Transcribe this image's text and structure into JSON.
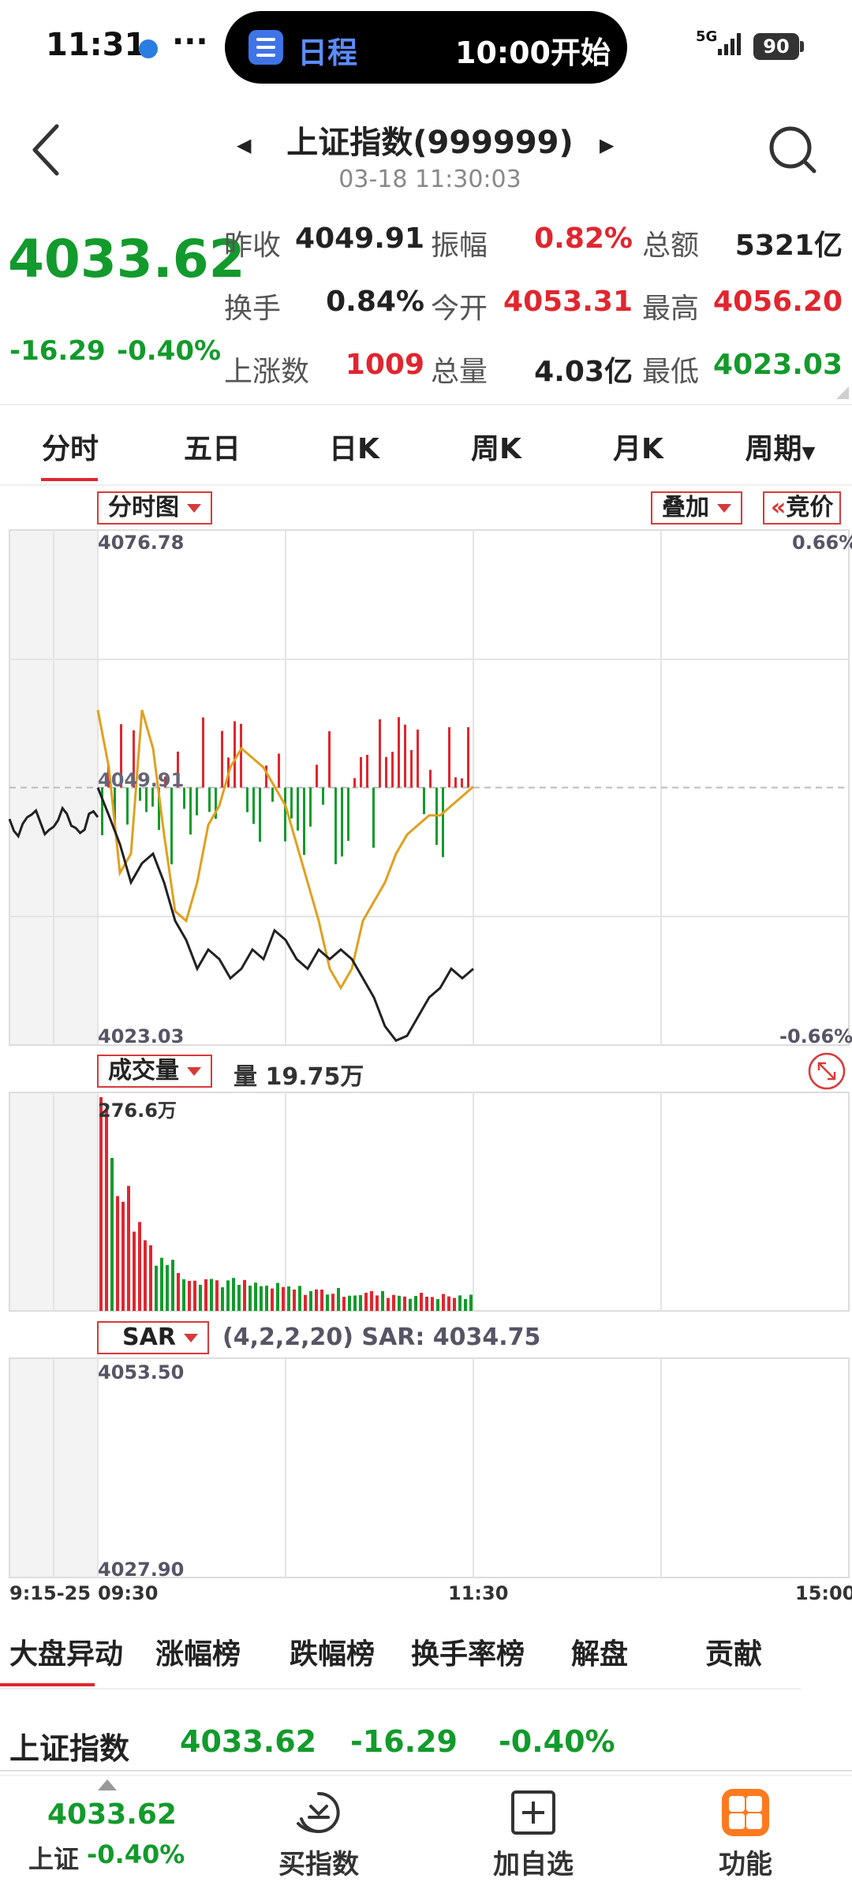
{
  "status_bar": {
    "time": "11:31",
    "more": "···",
    "schedule_label": "日程",
    "schedule_time": "10:00开始",
    "network": "5G",
    "battery": "90"
  },
  "header": {
    "title": "上证指数(999999)",
    "datetime": "03-18 11:30:03"
  },
  "quote": {
    "price": "4033.62",
    "change": "-16.29",
    "change_pct": "-0.40%",
    "stats": [
      {
        "label": "昨收",
        "value": "4049.91",
        "color": "#222222"
      },
      {
        "label": "振幅",
        "value": "0.82%",
        "color": "#e0262f"
      },
      {
        "label": "总额",
        "value": "5321亿",
        "color": "#222222"
      },
      {
        "label": "换手",
        "value": "0.84%",
        "color": "#222222"
      },
      {
        "label": "今开",
        "value": "4053.31",
        "color": "#e0262f"
      },
      {
        "label": "最高",
        "value": "4056.20",
        "color": "#e0262f"
      },
      {
        "label": "上涨数",
        "value": "1009",
        "color": "#e0262f"
      },
      {
        "label": "总量",
        "value": "4.03亿",
        "color": "#222222"
      },
      {
        "label": "最低",
        "value": "4023.03",
        "color": "#139a2c"
      }
    ]
  },
  "tabs": [
    "分时",
    "五日",
    "日K",
    "周K",
    "月K",
    "周期"
  ],
  "chart": {
    "main_dropdown": "分时图",
    "overlay_button": "叠加",
    "auction_button": "竞价",
    "price_high": "4076.78",
    "price_mid": "4049.91",
    "price_low": "4023.03",
    "pct_high": "0.66%",
    "pct_low": "-0.66%",
    "volume_dropdown": "成交量",
    "volume_text": "量 19.75万",
    "volume_max": "276.6万",
    "sar_dropdown": "SAR",
    "sar_text": "(4,2,2,20) SAR: 4034.75",
    "sar_high": "4053.50",
    "sar_low": "4027.90",
    "time_start": "9:15-25",
    "time_open": "09:30",
    "time_mid": "11:30",
    "time_end": "15:00"
  },
  "colors": {
    "up": "#e0262f",
    "down": "#139a2c",
    "price_line": "#222222",
    "avg_line": "#e0a020"
  },
  "chart_data": {
    "type": "line",
    "ylim": [
      4023.03,
      4076.78
    ],
    "reference_price": 4049.91,
    "price_series": [
      4049.9,
      4047,
      4044,
      4040,
      4042,
      4043,
      4040,
      4036,
      4034,
      4031,
      4033,
      4032,
      4030,
      4031,
      4033,
      4032,
      4035,
      4034,
      4032,
      4031,
      4033,
      4032,
      4033,
      4032,
      4030,
      4028,
      4025,
      4023.5,
      4024,
      4026,
      4028,
      4029,
      4031,
      4030,
      4031
    ],
    "avg_series": [
      4058,
      4052,
      4041,
      4043,
      4058,
      4054,
      4045,
      4037,
      4036,
      4040,
      4046,
      4048,
      4052,
      4054,
      4053,
      4052,
      4050,
      4048,
      4044,
      4040,
      4036,
      4031,
      4029,
      4031,
      4036,
      4038,
      4040,
      4043,
      4045,
      4046,
      4047,
      4047,
      4048,
      4049,
      4050
    ],
    "volume_max": 276.6,
    "volume_unit": "万"
  },
  "bottom_tabs": [
    "大盘异动",
    "涨幅榜",
    "跌幅榜",
    "换手率榜",
    "解盘",
    "贡献"
  ],
  "index_row": {
    "name": "上证指数",
    "price": "4033.62",
    "change": "-16.29",
    "pct": "-0.40%"
  },
  "bottom_nav": {
    "price": "4033.62",
    "index_name": "上证",
    "index_pct": "-0.40%",
    "items": [
      "买指数",
      "加自选",
      "功能"
    ]
  }
}
